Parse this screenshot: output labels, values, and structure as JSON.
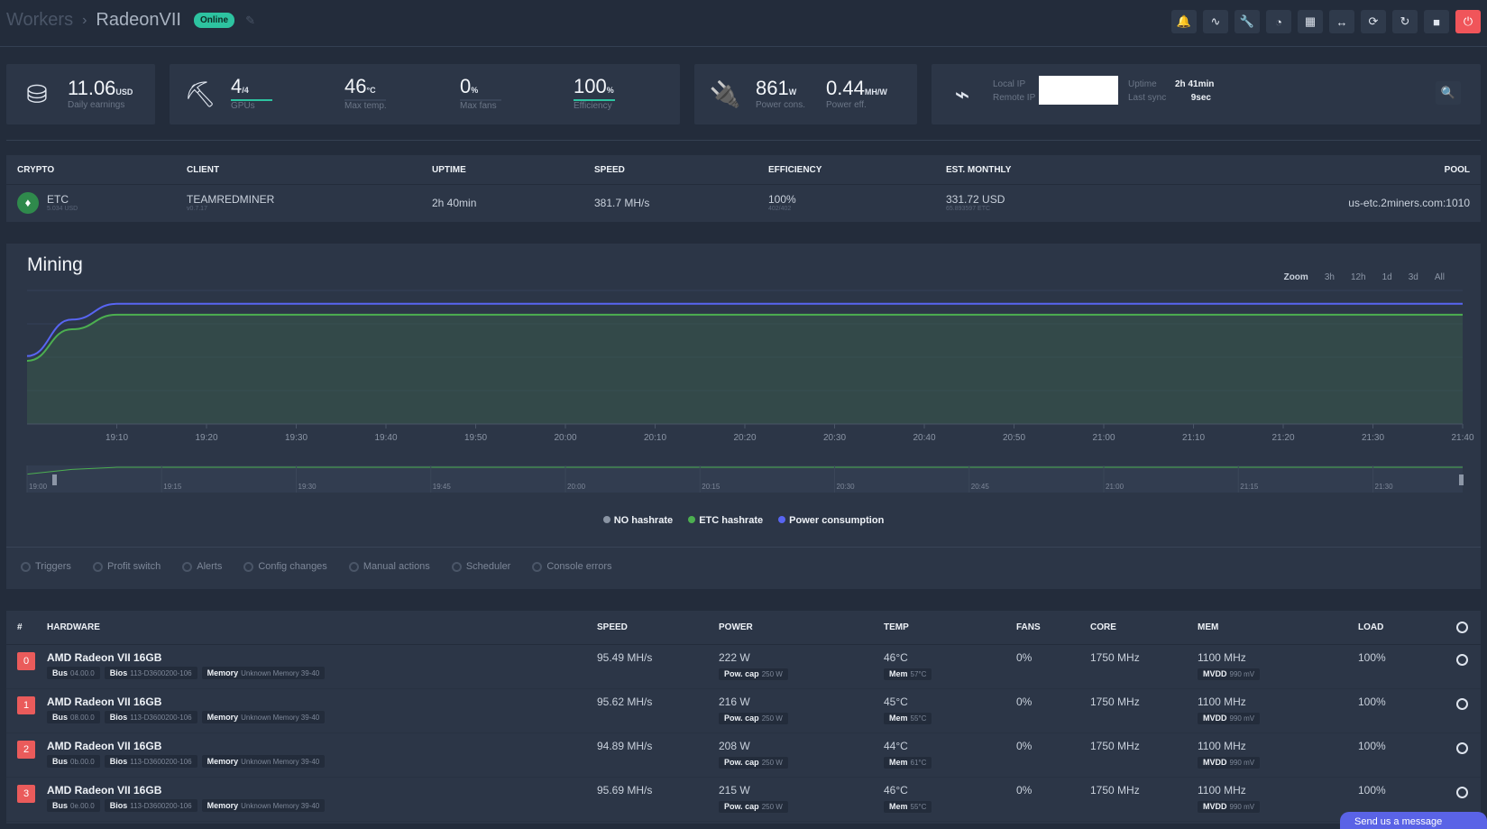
{
  "breadcrumb": {
    "parent": "Workers",
    "separator": "›",
    "current": "RadeonVII",
    "status": "Online"
  },
  "toolbar": {
    "icons": [
      "bell-icon",
      "pulse-icon",
      "wrench-icon",
      "gauge-icon",
      "gpu-icon",
      "swap-icon",
      "refresh-icon",
      "restart-icon",
      "stop-icon",
      "power-icon"
    ]
  },
  "summary": {
    "earnings": {
      "value": "11.06",
      "unit": "USD",
      "label": "Daily earnings"
    },
    "gpus": {
      "value": "4",
      "unit": "/4",
      "label": "GPUs"
    },
    "max_temp": {
      "value": "46",
      "unit": "°C",
      "label": "Max temp."
    },
    "max_fans": {
      "value": "0",
      "unit": "%",
      "label": "Max fans"
    },
    "efficiency": {
      "value": "100",
      "unit": "%",
      "label": "Efficiency"
    },
    "power": {
      "value": "861",
      "unit": "W",
      "label": "Power cons."
    },
    "power_eff": {
      "value": "0.44",
      "unit": "MH/W",
      "label": "Power eff."
    },
    "local_ip_label": "Local IP",
    "remote_ip_label": "Remote IP",
    "uptime_label": "Uptime",
    "uptime_value": "2h 41min",
    "last_sync_label": "Last sync",
    "last_sync_value": "9sec"
  },
  "crypto_table": {
    "headers": {
      "crypto": "CRYPTO",
      "client": "CLIENT",
      "uptime": "UPTIME",
      "speed": "SPEED",
      "efficiency": "EFFICIENCY",
      "est_monthly": "EST. MONTHLY",
      "pool": "POOL"
    },
    "row": {
      "coin": "ETC",
      "coin_price": "5.034 USD",
      "client": "TEAMREDMINER",
      "client_version": "v0.7.17",
      "uptime": "2h 40min",
      "speed": "381.7 MH/s",
      "efficiency": "100%",
      "efficiency_sub": "402/402",
      "est_monthly": "331.72 USD",
      "est_monthly_sub": "65.893597 ETC",
      "pool": "us-etc.2miners.com:1010"
    }
  },
  "mining": {
    "title": "Mining",
    "zoom_label": "Zoom",
    "zoom_options": [
      "3h",
      "12h",
      "1d",
      "3d",
      "All"
    ],
    "legend": [
      {
        "label": "NO hashrate",
        "color": "#8a94a3"
      },
      {
        "label": "ETC hashrate",
        "color": "#4caf50"
      },
      {
        "label": "Power consumption",
        "color": "#5865f2"
      }
    ],
    "events": [
      "Triggers",
      "Profit switch",
      "Alerts",
      "Config changes",
      "Manual actions",
      "Scheduler",
      "Console errors"
    ]
  },
  "chart_data": {
    "type": "area",
    "x": [
      "19:00",
      "19:05",
      "19:10",
      "19:20",
      "19:30",
      "19:40",
      "19:50",
      "20:00",
      "20:10",
      "20:20",
      "20:30",
      "20:40",
      "20:50",
      "21:00",
      "21:10",
      "21:20",
      "21:30",
      "21:40"
    ],
    "x_ticks": [
      "19:10",
      "19:20",
      "19:30",
      "19:40",
      "19:50",
      "20:00",
      "20:10",
      "20:20",
      "20:30",
      "20:40",
      "20:50",
      "21:00",
      "21:10",
      "21:20",
      "21:30",
      "21:40"
    ],
    "navigator_ticks": [
      "19:00",
      "19:15",
      "19:30",
      "19:45",
      "20:00",
      "20:15",
      "20:30",
      "20:45",
      "21:00",
      "21:15",
      "21:30"
    ],
    "series": [
      {
        "name": "ETC hashrate",
        "values": [
          52,
          78,
          90,
          90,
          90,
          90,
          90,
          90,
          90,
          90,
          90,
          90,
          90,
          90,
          90,
          90,
          90,
          90
        ]
      },
      {
        "name": "Power consumption",
        "values": [
          56,
          86,
          99,
          99,
          99,
          99,
          99,
          99,
          99,
          99,
          99,
          99,
          99,
          99,
          99,
          99,
          99,
          99
        ]
      }
    ],
    "legend_position": "bottom"
  },
  "hardware": {
    "headers": {
      "num": "#",
      "hardware": "HARDWARE",
      "speed": "SPEED",
      "power": "POWER",
      "temp": "TEMP",
      "fans": "FANS",
      "core": "CORE",
      "mem": "MEM",
      "load": "LOAD"
    },
    "tag_labels": {
      "bus": "Bus",
      "bios": "Bios",
      "memory": "Memory",
      "pow_cap": "Pow. cap",
      "mem_temp": "Mem",
      "mvdd": "MVDD"
    },
    "rows": [
      {
        "num": "0",
        "name": "AMD Radeon VII 16GB",
        "bus": "04.00.0",
        "bios": "113-D3600200-106",
        "memory": "Unknown Memory 39-40",
        "speed": "95.49 MH/s",
        "power": "222 W",
        "pow_cap": "250 W",
        "temp": "46°C",
        "mem_temp": "57°C",
        "fans": "0%",
        "core": "1750 MHz",
        "mem": "1100 MHz",
        "mvdd": "990 mV",
        "load": "100%"
      },
      {
        "num": "1",
        "name": "AMD Radeon VII 16GB",
        "bus": "08.00.0",
        "bios": "113-D3600200-106",
        "memory": "Unknown Memory 39-40",
        "speed": "95.62 MH/s",
        "power": "216 W",
        "pow_cap": "250 W",
        "temp": "45°C",
        "mem_temp": "55°C",
        "fans": "0%",
        "core": "1750 MHz",
        "mem": "1100 MHz",
        "mvdd": "990 mV",
        "load": "100%"
      },
      {
        "num": "2",
        "name": "AMD Radeon VII 16GB",
        "bus": "0b.00.0",
        "bios": "113-D3600200-106",
        "memory": "Unknown Memory 39-40",
        "speed": "94.89 MH/s",
        "power": "208 W",
        "pow_cap": "250 W",
        "temp": "44°C",
        "mem_temp": "61°C",
        "fans": "0%",
        "core": "1750 MHz",
        "mem": "1100 MHz",
        "mvdd": "990 mV",
        "load": "100%"
      },
      {
        "num": "3",
        "name": "AMD Radeon VII 16GB",
        "bus": "0e.00.0",
        "bios": "113-D3600200-106",
        "memory": "Unknown Memory 39-40",
        "speed": "95.69 MH/s",
        "power": "215 W",
        "pow_cap": "250 W",
        "temp": "46°C",
        "mem_temp": "55°C",
        "fans": "0%",
        "core": "1750 MHz",
        "mem": "1100 MHz",
        "mvdd": "990 mV",
        "load": "100%"
      }
    ]
  },
  "chat": {
    "label": "Send us a message"
  }
}
